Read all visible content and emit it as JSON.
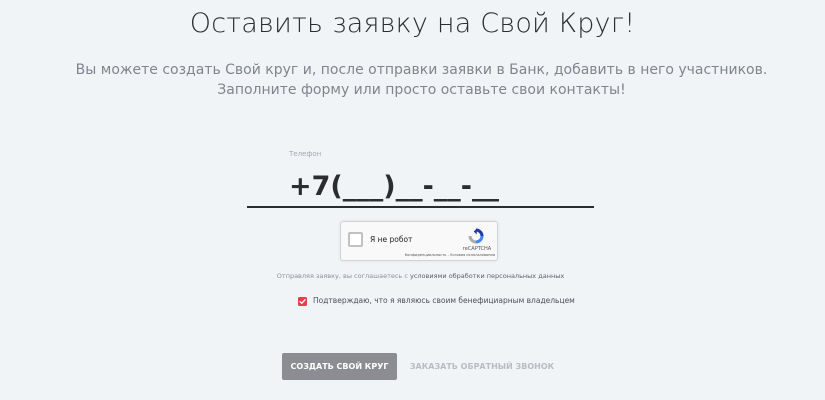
{
  "header": {
    "title": "Оставить заявку на Свой Круг!",
    "subtitle_line1": "Вы можете создать Свой круг и, после отправки заявки в Банк, добавить в него участников.",
    "subtitle_line2": "Заполните форму или просто оставьте свои контакты!"
  },
  "form": {
    "phone_label": "Телефон",
    "phone_placeholder": "+7(___)__-__-__",
    "phone_value": "",
    "recaptcha": {
      "label": "Я не робот",
      "brand": "reCAPTCHA",
      "privacy_link": "Конфиденциальность",
      "separator": " - ",
      "terms_link": "Условия использования",
      "checked": false
    },
    "consent_prefix": "Отправляя заявку, вы соглашаетесь с ",
    "consent_link": "условиями обработки персональных данных",
    "beneficiary_label": "Подтверждаю, что я являюсь своим бенефициарным владельцем",
    "beneficiary_checked": true,
    "checkbox_color": "#e83e4a"
  },
  "actions": {
    "primary_label": "СОЗДАТЬ СВОЙ КРУГ",
    "secondary_label": "ЗАКАЗАТЬ ОБРАТНЫЙ ЗВОНОК"
  },
  "colors": {
    "background": "#f1f4f7",
    "primary_button": "#8b8d92",
    "accent": "#e83e4a"
  },
  "icons": {
    "recaptcha_logo": "recaptcha-logo-icon",
    "checkmark": "checkmark-icon"
  }
}
